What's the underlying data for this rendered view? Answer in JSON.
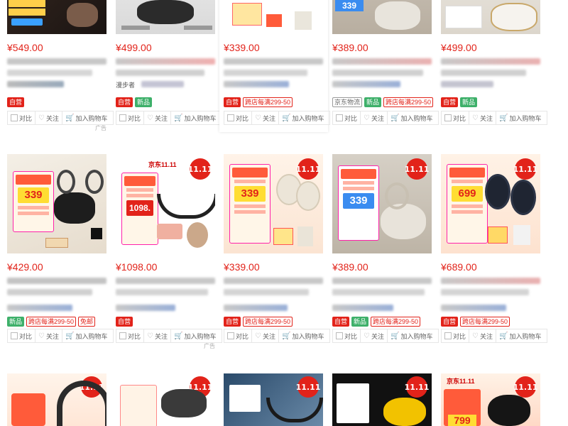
{
  "actions": {
    "compare": "对比",
    "follow": "关注",
    "add_cart": "加入购物车"
  },
  "ad_label": "广告",
  "tag_texts": {
    "self": "自营",
    "new": "新品",
    "jd": "京东物流",
    "cross": "跨店每满299-50",
    "coupon": "免邮"
  },
  "badge_text": "11.11",
  "rows": [
    {
      "cards": [
        {
          "price": "¥549.00",
          "tags": [
            "self"
          ]
        },
        {
          "price": "¥499.00",
          "tags": [
            "self",
            "new"
          ],
          "subtext": "漫步者"
        },
        {
          "price": "¥339.00",
          "tags": [
            "self",
            "cross"
          ]
        },
        {
          "price": "¥389.00",
          "tags": [
            "jd",
            "new",
            "cross"
          ]
        },
        {
          "price": "¥499.00",
          "tags": [
            "self",
            "new"
          ]
        }
      ]
    },
    {
      "cards": [
        {
          "price": "¥429.00",
          "tags": [
            "new",
            "cross",
            "coupon"
          ],
          "promo": "339"
        },
        {
          "price": "¥1098.00",
          "tags": [
            "self"
          ],
          "promo": "1098.",
          "logo": "京东11.11"
        },
        {
          "price": "¥339.00",
          "tags": [
            "self",
            "cross"
          ],
          "promo": "339"
        },
        {
          "price": "¥389.00",
          "tags": [
            "self",
            "new",
            "cross"
          ],
          "promo": "339"
        },
        {
          "price": "¥689.00",
          "tags": [
            "self",
            "cross"
          ],
          "promo": "699"
        }
      ]
    },
    {
      "cards": [
        {
          "promo": ""
        },
        {
          "promo": ""
        },
        {
          "promo": ""
        },
        {
          "promo": ""
        },
        {
          "promo": "799",
          "logo": "京东11.11"
        }
      ]
    }
  ]
}
